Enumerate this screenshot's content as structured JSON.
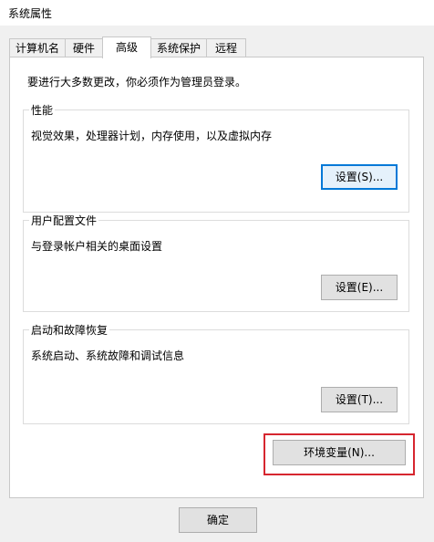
{
  "window": {
    "title": "系统属性"
  },
  "tabs": [
    {
      "label": "计算机名"
    },
    {
      "label": "硬件"
    },
    {
      "label": "高级",
      "active": true
    },
    {
      "label": "系统保护"
    },
    {
      "label": "远程"
    }
  ],
  "notice": "要进行大多数更改，你必须作为管理员登录。",
  "performance": {
    "label": "性能",
    "desc": "视觉效果，处理器计划，内存使用，以及虚拟内存",
    "button": "设置(S)..."
  },
  "profile": {
    "label": "用户配置文件",
    "desc": "与登录帐户相关的桌面设置",
    "button": "设置(E)..."
  },
  "startup": {
    "label": "启动和故障恢复",
    "desc": "系统启动、系统故障和调试信息",
    "button": "设置(T)..."
  },
  "env_button": "环境变量(N)...",
  "ok_button": "确定",
  "colors": {
    "focus_blue": "#0078d7",
    "highlight_red": "#d6262f"
  }
}
